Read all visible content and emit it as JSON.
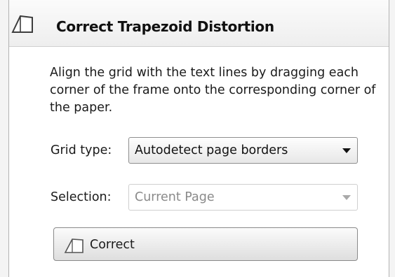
{
  "panel": {
    "title": "Correct Trapezoid Distortion",
    "title_icon": "trapezoid-icon",
    "description": "Align the grid with the text lines by dragging each corner of the frame onto the corresponding corner of the paper."
  },
  "grid_type": {
    "label": "Grid type:",
    "value": "Autodetect page borders"
  },
  "selection": {
    "label": "Selection:",
    "value": "Current Page",
    "disabled": true
  },
  "correct_button": {
    "label": "Correct",
    "icon": "trapezoid-icon"
  }
}
